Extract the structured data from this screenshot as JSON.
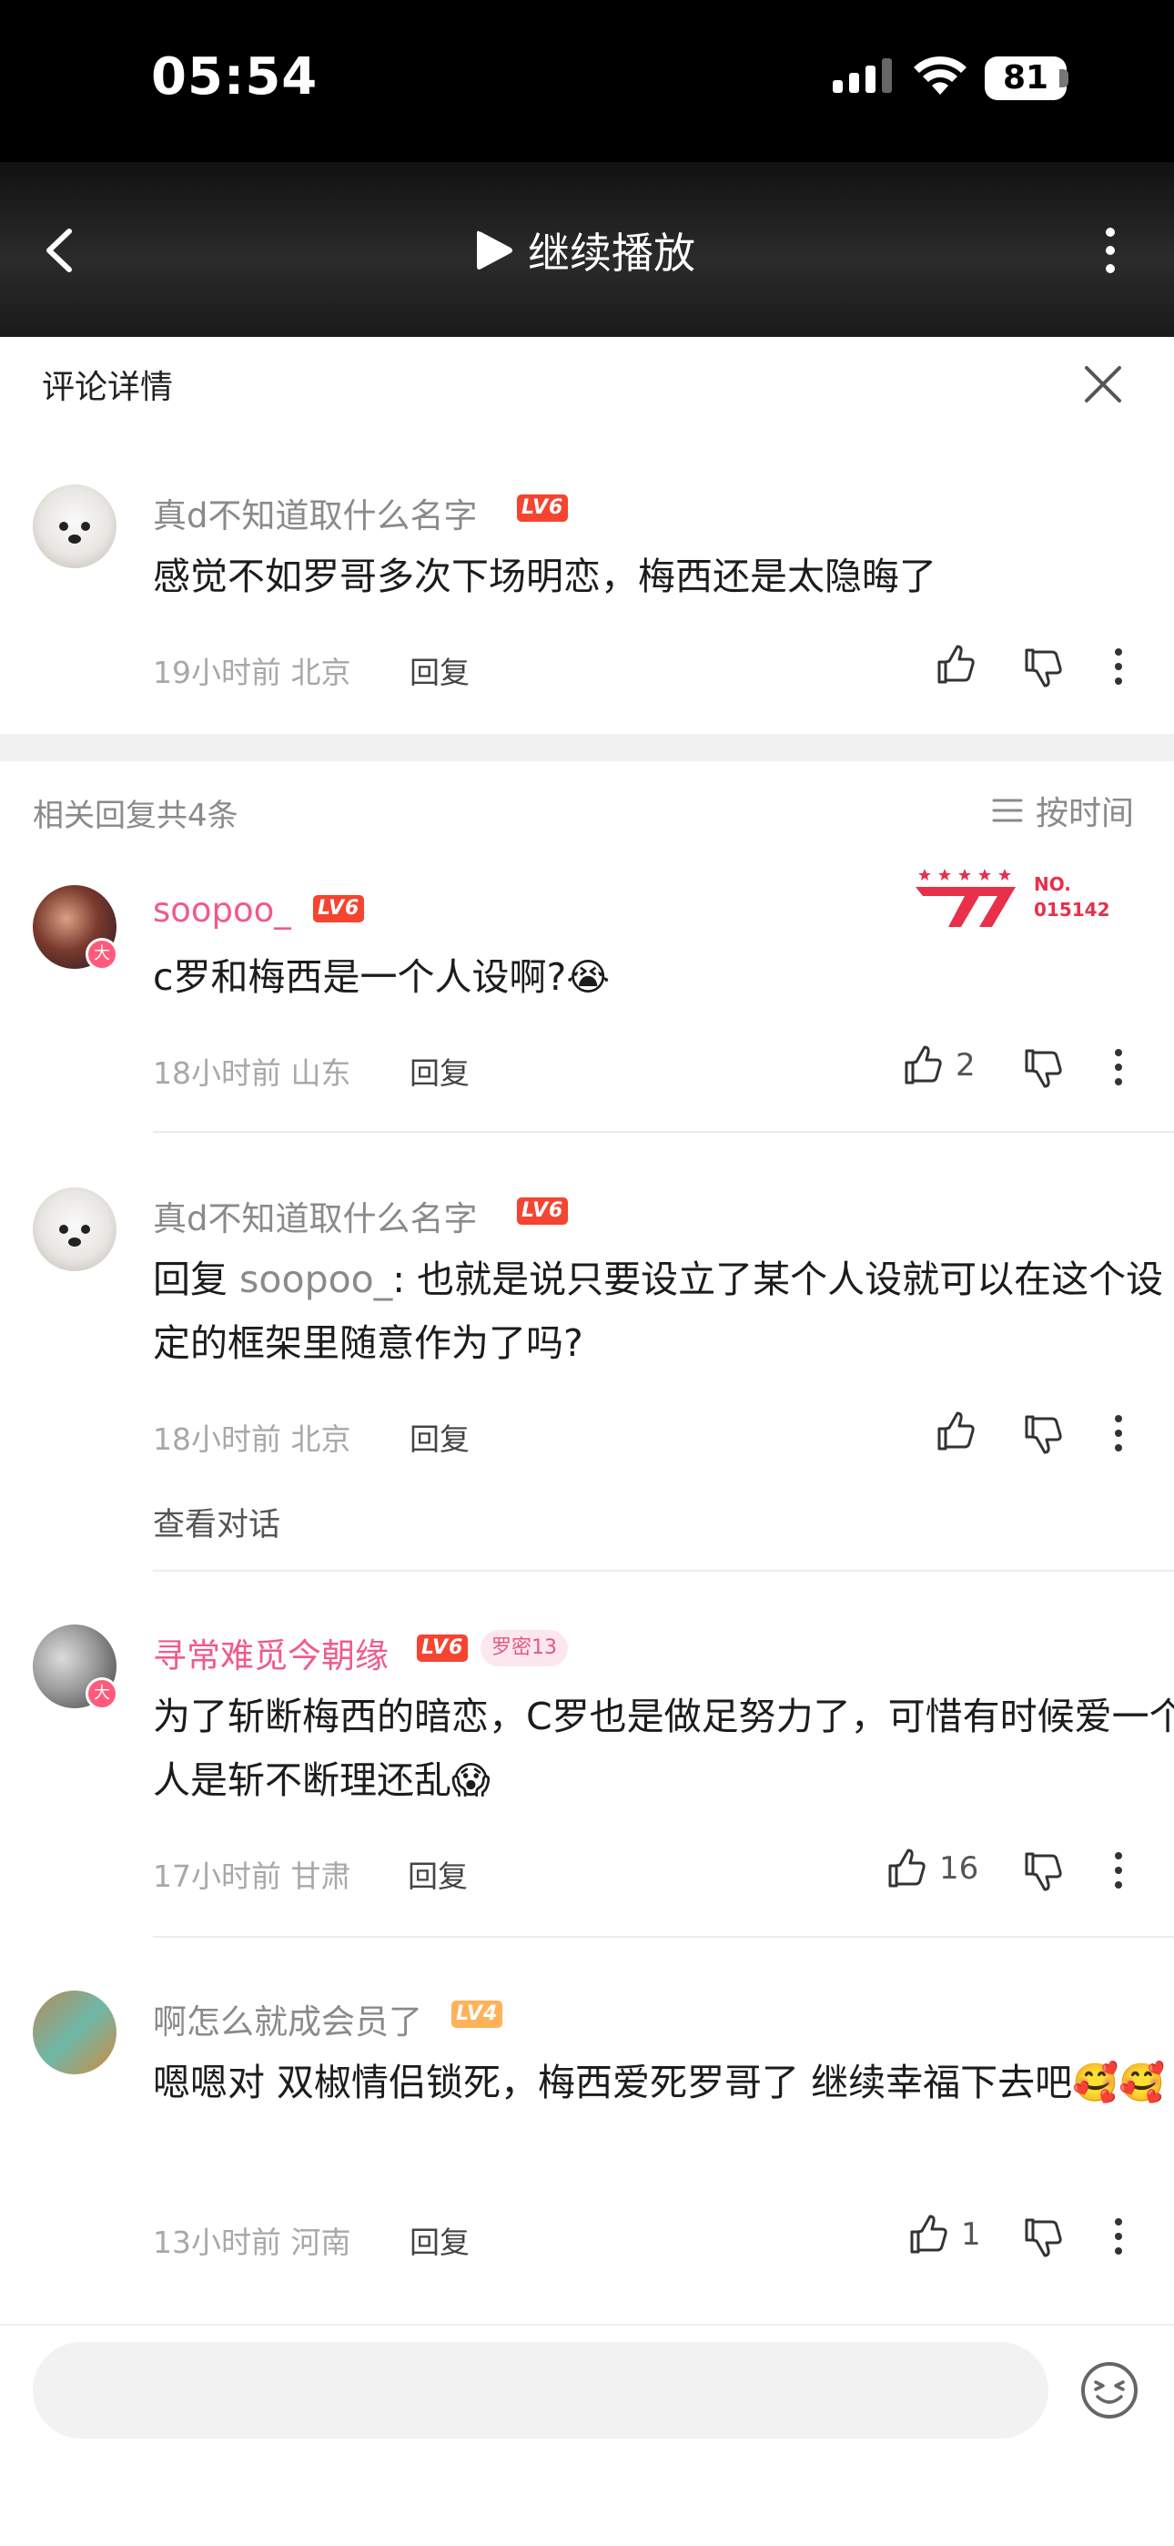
{
  "status_bar": {
    "time": "05:54",
    "battery": "81"
  },
  "header": {
    "continue_label": "继续播放"
  },
  "sheet": {
    "title": "评论详情"
  },
  "main_comment": {
    "user": "真d不知道取什么名字",
    "level": "LV6",
    "text": "感觉不如罗哥多次下场明恋，梅西还是太隐晦了",
    "meta": "19小时前 北京",
    "reply_label": "回复"
  },
  "replies_header": {
    "count_text": "相关回复共4条",
    "sort_label": "按时间"
  },
  "replies": [
    {
      "user": "soopoo_",
      "level": "LV6",
      "badge_no": "NO.",
      "badge_id": "015142",
      "text": "c罗和梅西是一个人设啊?😭",
      "meta": "18小时前 山东",
      "reply_label": "回复",
      "likes": "2"
    },
    {
      "user": "真d不知道取什么名字",
      "level": "LV6",
      "reply_prefix": "回复 ",
      "reply_to": "soopoo_",
      "text": ": 也就是说只要设立了某个人设就可以在这个设定的框架里随意作为了吗?",
      "meta": "18小时前 北京",
      "reply_label": "回复",
      "view_conversation": "查看对话"
    },
    {
      "user": "寻常难觅今朝缘",
      "level": "LV6",
      "fan_badge": "罗密13",
      "text": "为了斩断梅西的暗恋，C罗也是做足努力了，可惜有时候爱一个人是斩不断理还乱😱",
      "meta": "17小时前 甘肃",
      "reply_label": "回复",
      "likes": "16"
    },
    {
      "user": "啊怎么就成会员了",
      "level": "LV4",
      "text": "嗯嗯对 双椒情侣锁死，梅西爱死罗哥了 继续幸福下去吧🥰🥰",
      "meta": "13小时前 河南",
      "reply_label": "回复",
      "likes": "1"
    }
  ],
  "input": {
    "placeholder": ""
  },
  "colors": {
    "accent_pink": "#ef5b8a",
    "level_red": "#f5442f",
    "level_orange": "#ffb258",
    "badge_red": "#e8304a"
  },
  "icons": [
    "chevron-left-icon",
    "play-icon",
    "more-vertical-icon",
    "close-icon",
    "thumb-up-icon",
    "thumb-down-icon",
    "sort-lines-icon",
    "emoji-icon"
  ]
}
